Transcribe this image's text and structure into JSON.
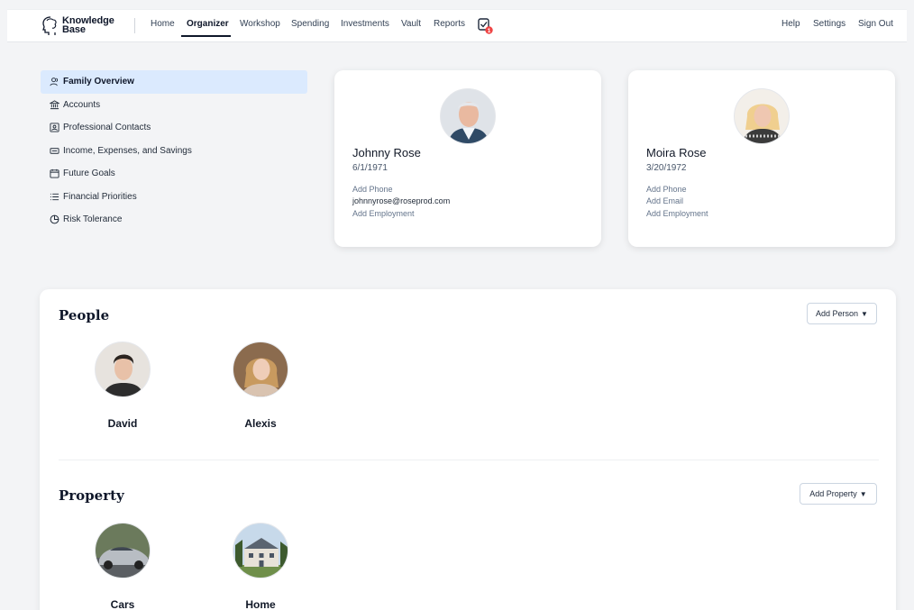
{
  "nav": {
    "logo_line1": "Knowledge",
    "logo_line2": "Base",
    "items": [
      "Home",
      "Organizer",
      "Workshop",
      "Spending",
      "Investments",
      "Vault",
      "Reports"
    ],
    "right_items": [
      "Help",
      "Settings",
      "Sign Out"
    ],
    "task_badge": "1"
  },
  "sidebar": {
    "items": [
      {
        "label": "Family Overview",
        "icon": "people-icon"
      },
      {
        "label": "Accounts",
        "icon": "bank-icon"
      },
      {
        "label": "Professional Contacts",
        "icon": "contact-card-icon"
      },
      {
        "label": "Income, Expenses, and Savings",
        "icon": "cash-icon"
      },
      {
        "label": "Future Goals",
        "icon": "calendar-icon"
      },
      {
        "label": "Financial Priorities",
        "icon": "list-icon"
      },
      {
        "label": "Risk Tolerance",
        "icon": "pie-chart-icon"
      }
    ]
  },
  "members": [
    {
      "name": "Johnny Rose",
      "dob": "6/1/1971",
      "phone": "Add Phone",
      "email": "johnnyrose@roseprod.com",
      "employment": "Add Employment"
    },
    {
      "name": "Moira Rose",
      "dob": "3/20/1972",
      "phone": "Add Phone",
      "email": "Add Email",
      "employment": "Add Employment"
    }
  ],
  "people": {
    "title": "People",
    "add_label": "Add Person",
    "items": [
      "David",
      "Alexis"
    ]
  },
  "property": {
    "title": "Property",
    "add_label": "Add Property",
    "items": [
      "Cars",
      "Home"
    ]
  },
  "colors": {
    "active_sidebar": "#dbeafe",
    "badge": "#ef4444",
    "page_bg": "#f3f4f6"
  }
}
